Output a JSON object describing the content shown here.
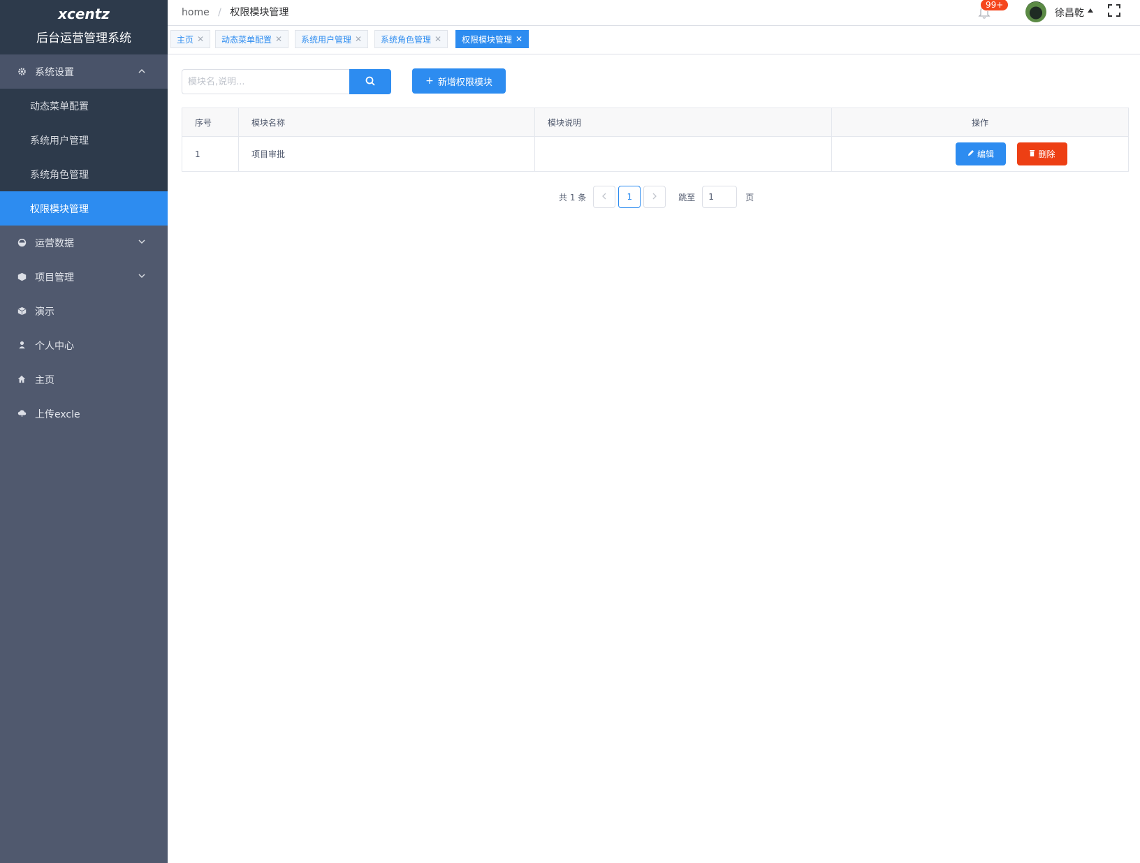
{
  "brand": {
    "name": "xcentz",
    "subtitle": "后台运营管理系统"
  },
  "sidebar": {
    "group": {
      "label": "系统设置",
      "icon": "gear-icon",
      "items": [
        {
          "label": "动态菜单配置",
          "active": false
        },
        {
          "label": "系统用户管理",
          "active": false
        },
        {
          "label": "系统角色管理",
          "active": false
        },
        {
          "label": "权限模块管理",
          "active": true
        }
      ]
    },
    "items": [
      {
        "label": "运营数据",
        "icon": "chart-icon",
        "expandable": true
      },
      {
        "label": "项目管理",
        "icon": "cube-icon",
        "expandable": true
      },
      {
        "label": "演示",
        "icon": "box-icon",
        "expandable": false
      },
      {
        "label": "个人中心",
        "icon": "user-icon",
        "expandable": false
      },
      {
        "label": "主页",
        "icon": "home-icon",
        "expandable": false
      },
      {
        "label": "上传excle",
        "icon": "cloud-upload-icon",
        "expandable": false
      }
    ]
  },
  "header": {
    "breadcrumb_home": "home",
    "breadcrumb_sep": "/",
    "breadcrumb_current": "权限模块管理",
    "notification_badge": "99+",
    "username": "徐昌乾"
  },
  "tags": [
    {
      "label": "主页",
      "active": false
    },
    {
      "label": "动态菜单配置",
      "active": false
    },
    {
      "label": "系统用户管理",
      "active": false
    },
    {
      "label": "系统角色管理",
      "active": false
    },
    {
      "label": "权限模块管理",
      "active": true
    }
  ],
  "toolbar": {
    "search_placeholder": "模块名,说明...",
    "add_button_label": "新增权限模块"
  },
  "table": {
    "columns": [
      "序号",
      "模块名称",
      "模块说明",
      "操作"
    ],
    "rows": [
      {
        "index": "1",
        "name": "项目审批",
        "description": ""
      }
    ],
    "edit_label": "编辑",
    "delete_label": "删除"
  },
  "pagination": {
    "total_text": "共 1 条",
    "current_page": "1",
    "jump_label": "跳至",
    "jump_value": "1",
    "page_suffix": "页"
  },
  "colors": {
    "primary": "#2d8cf0",
    "danger": "#ed3f14",
    "sidebar_bg": "#50596e",
    "sidebar_dark": "#2d3a4b"
  }
}
